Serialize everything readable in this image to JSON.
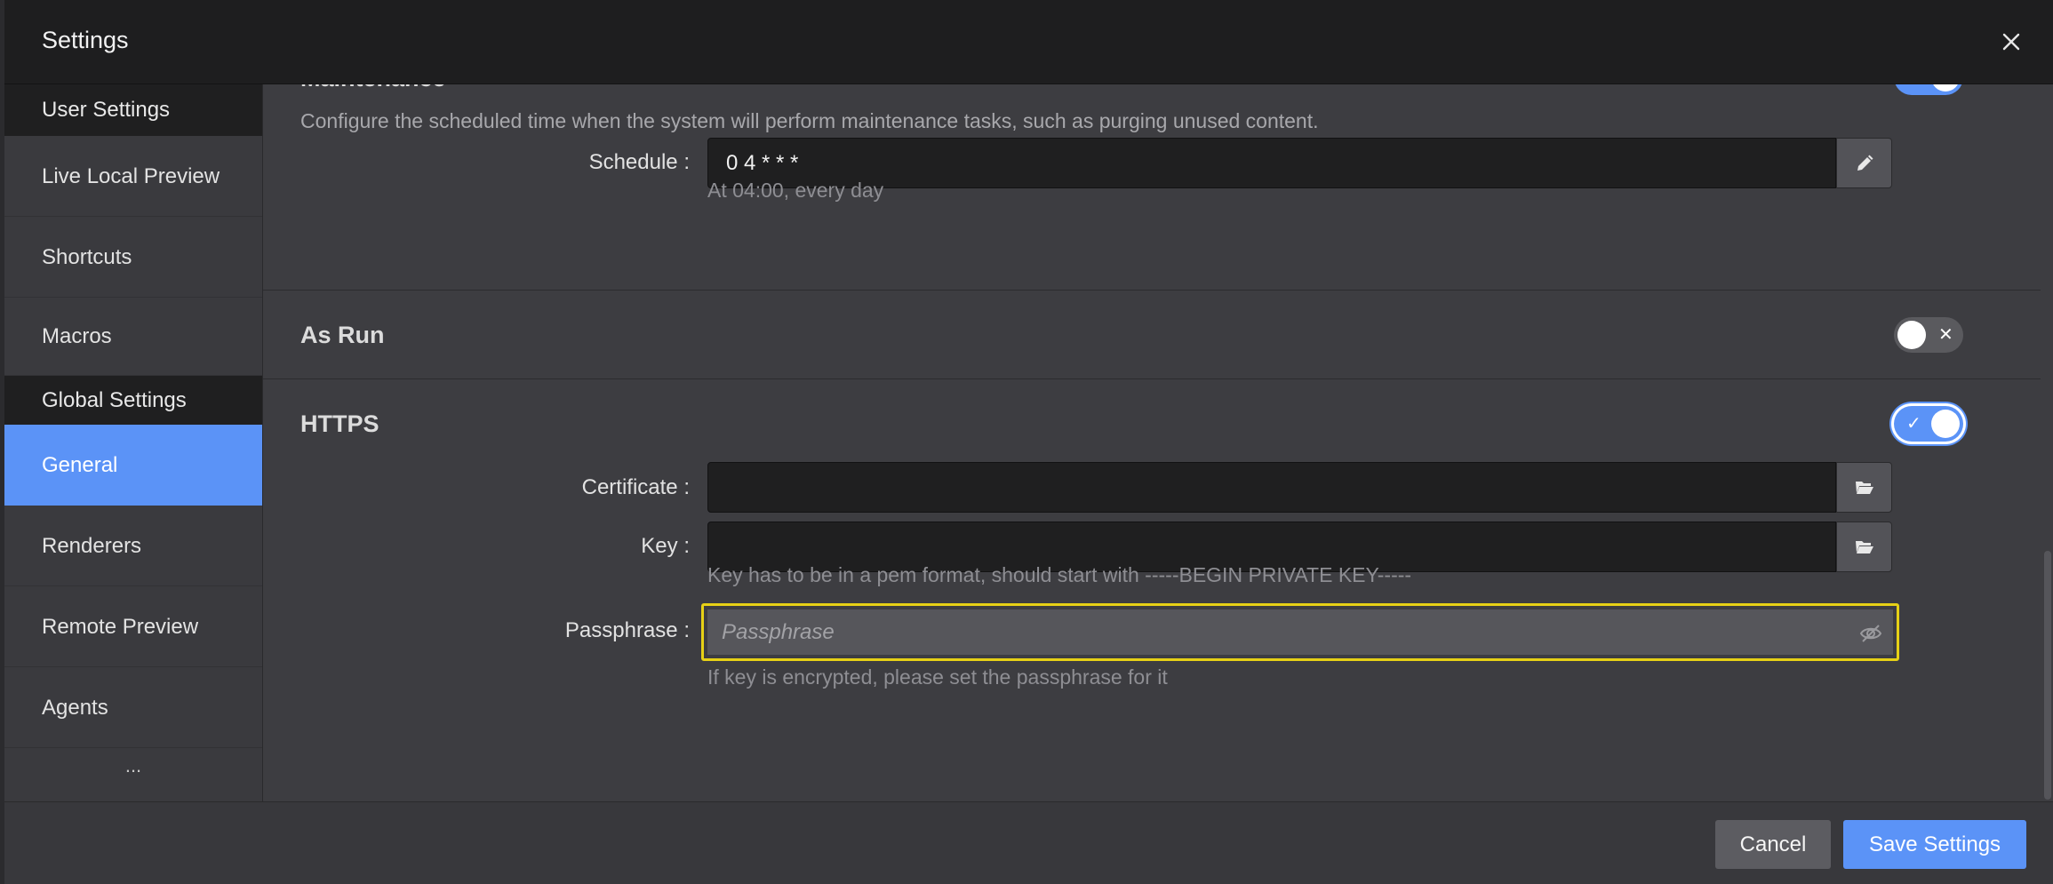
{
  "dialog": {
    "title": "Settings"
  },
  "sidebar": {
    "groups": [
      {
        "label": "User Settings"
      },
      {
        "label": "Global Settings"
      }
    ],
    "user_items": [
      {
        "label": "Live Local Preview"
      },
      {
        "label": "Shortcuts"
      },
      {
        "label": "Macros"
      }
    ],
    "global_items": [
      {
        "label": "General",
        "active": true
      },
      {
        "label": "Renderers"
      },
      {
        "label": "Remote Preview"
      },
      {
        "label": "Agents"
      }
    ],
    "more": "..."
  },
  "maintenance": {
    "title": "Maintenance",
    "enabled": true,
    "description": "Configure the scheduled time when the system will perform maintenance tasks, such as purging unused content.",
    "schedule_label": "Schedule",
    "schedule_value": "0 4 * * *",
    "schedule_hint": "At 04:00, every day"
  },
  "as_run": {
    "title": "As Run",
    "enabled": false,
    "toggle_mark": "✕"
  },
  "https": {
    "title": "HTTPS",
    "enabled": true,
    "toggle_mark": "✓",
    "certificate_label": "Certificate",
    "certificate_value": "",
    "key_label": "Key",
    "key_value": "",
    "key_hint": "Key has to be in a pem format, should start with -----BEGIN PRIVATE KEY-----",
    "passphrase_label": "Passphrase",
    "passphrase_placeholder": "Passphrase",
    "passphrase_hint": "If key is encrypted, please set the passphrase for it"
  },
  "footer": {
    "cancel_label": "Cancel",
    "save_label": "Save Settings"
  },
  "colors": {
    "accent": "#5b93f7",
    "focus_outline": "#e7d116",
    "header_bg": "#1e1e1f"
  }
}
